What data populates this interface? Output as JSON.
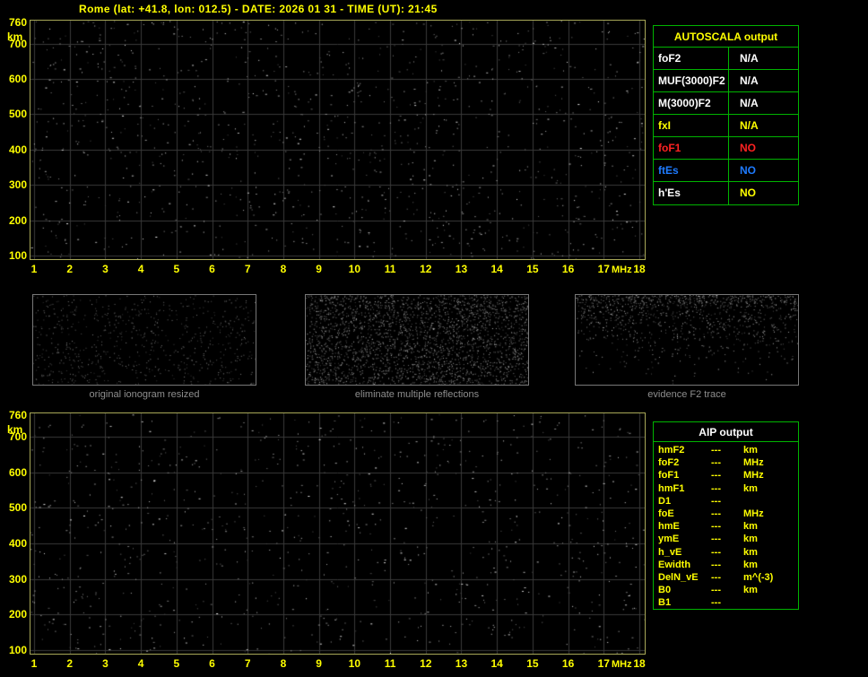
{
  "header": {
    "title": "Rome (lat: +41.8, lon: 012.5) - DATE: 2026 01 31 - TIME (UT): 21:45"
  },
  "ionogram": {
    "x_unit": "MHz",
    "y_unit": "km",
    "x_ticks": [
      1,
      2,
      3,
      4,
      5,
      6,
      7,
      8,
      9,
      10,
      11,
      12,
      13,
      14,
      15,
      16,
      17,
      18
    ],
    "y_ticks": [
      760,
      700,
      600,
      500,
      400,
      300,
      200,
      100
    ]
  },
  "autoscala": {
    "title": "AUTOSCALA output",
    "rows": [
      {
        "label": "foF2",
        "value": "N/A",
        "label_color": "#ffffff",
        "value_color": "#ffffff"
      },
      {
        "label": "MUF(3000)F2",
        "value": "N/A",
        "label_color": "#ffffff",
        "value_color": "#ffffff"
      },
      {
        "label": "M(3000)F2",
        "value": "N/A",
        "label_color": "#ffffff",
        "value_color": "#ffffff"
      },
      {
        "label": "fxI",
        "value": "N/A",
        "label_color": "#ffff00",
        "value_color": "#ffff00"
      },
      {
        "label": "foF1",
        "value": "NO",
        "label_color": "#ff2222",
        "value_color": "#ff2222"
      },
      {
        "label": "ftEs",
        "value": "NO",
        "label_color": "#1e7bff",
        "value_color": "#1e7bff"
      },
      {
        "label": "h'Es",
        "value": "NO",
        "label_color": "#ffffff",
        "value_color": "#ffff00"
      }
    ]
  },
  "thumbnails": [
    {
      "caption": "original ionogram resized"
    },
    {
      "caption": "eliminate multiple reflections"
    },
    {
      "caption": "evidence F2 trace"
    }
  ],
  "aip": {
    "title": "AIP output",
    "rows": [
      {
        "name": "hmF2",
        "value": "---",
        "unit": "km"
      },
      {
        "name": "foF2",
        "value": "---",
        "unit": "MHz"
      },
      {
        "name": "foF1",
        "value": "---",
        "unit": "MHz"
      },
      {
        "name": "hmF1",
        "value": "---",
        "unit": "km"
      },
      {
        "name": "D1",
        "value": "---",
        "unit": ""
      },
      {
        "name": "foE",
        "value": "---",
        "unit": "MHz"
      },
      {
        "name": "hmE",
        "value": "---",
        "unit": "km"
      },
      {
        "name": "ymE",
        "value": "---",
        "unit": "km"
      },
      {
        "name": "h_vE",
        "value": "---",
        "unit": "km"
      },
      {
        "name": "Ewidth",
        "value": "---",
        "unit": "km"
      },
      {
        "name": "DelN_vE",
        "value": "---",
        "unit": "m^(-3)"
      },
      {
        "name": "B0",
        "value": "---",
        "unit": "km"
      },
      {
        "name": "B1",
        "value": "---",
        "unit": ""
      }
    ]
  },
  "colors": {
    "background": "#000000",
    "accent_yellow": "#ffff00",
    "table_border_green": "#00b400",
    "grid": "#3a3a3a",
    "plot_border": "#a8a858",
    "caption_gray": "#8e8e8e"
  }
}
